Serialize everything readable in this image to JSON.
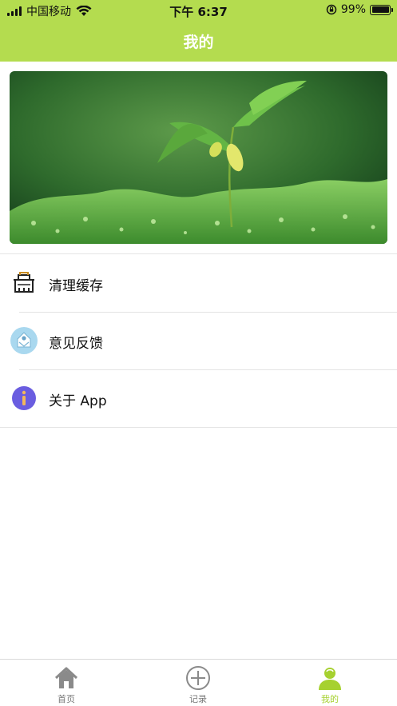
{
  "status_bar": {
    "carrier": "中国移动",
    "time": "下午 6:37",
    "battery": "99%"
  },
  "nav": {
    "title": "我的"
  },
  "banner": {
    "image": "green-sprout-photo"
  },
  "menu": [
    {
      "label": "清理缓存",
      "icon": "cleanup-basket-icon"
    },
    {
      "label": "意见反馈",
      "icon": "feedback-icon"
    },
    {
      "label": "关于 App",
      "icon": "info-icon"
    }
  ],
  "tabs": [
    {
      "label": "首页",
      "icon": "home-icon",
      "active": false
    },
    {
      "label": "记录",
      "icon": "add-circle-icon",
      "active": false
    },
    {
      "label": "我的",
      "icon": "profile-icon",
      "active": true
    }
  ],
  "colors": {
    "accent": "#b4dc4f",
    "tab_active": "#a6d12f",
    "tab_inactive": "#777777",
    "divider": "#e4e4e4"
  }
}
